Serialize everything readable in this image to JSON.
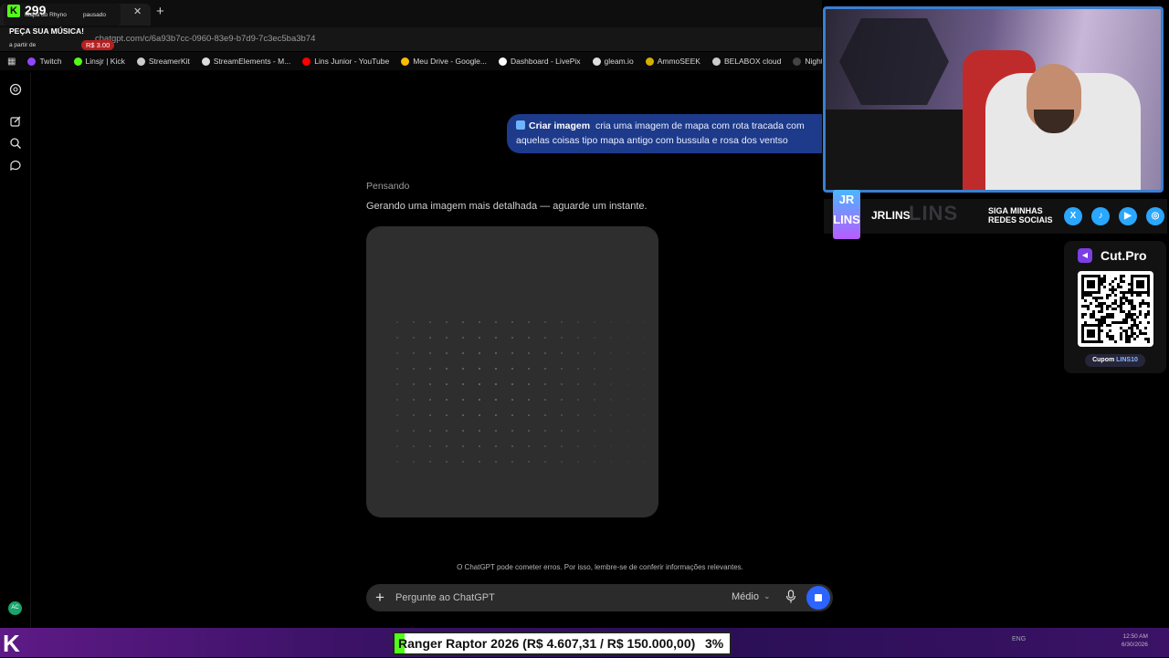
{
  "browser": {
    "tab_title": "Mapa do Rhyno",
    "url": "chatgpt.com/c/6a93b7cc-0960-83e9-b7d9-7c3ec5ba3b74",
    "bookmarks": [
      {
        "label": "Twitch",
        "color": "#9146ff"
      },
      {
        "label": "Linsjr | Kick",
        "color": "#53fc18"
      },
      {
        "label": "StreamerKit",
        "color": "#cccccc"
      },
      {
        "label": "StreamElements - M...",
        "color": "#dddddd"
      },
      {
        "label": "Lins Junior - YouTube",
        "color": "#ff0000"
      },
      {
        "label": "Meu Drive - Google...",
        "color": "#fbbc04"
      },
      {
        "label": "Dashboard - LivePix",
        "color": "#ffffff"
      },
      {
        "label": "gleam.io",
        "color": "#e0e0e0"
      },
      {
        "label": "AmmoSEEK",
        "color": "#d4b000"
      },
      {
        "label": "BELABOX cloud",
        "color": "#cccccc"
      },
      {
        "label": "Nightbot - Comm",
        "color": "#444444"
      }
    ]
  },
  "kick_overlay": {
    "count": "299",
    "song_label": "Mapa do Rhyno",
    "status": "pausado",
    "song_request": "PEÇA SUA MÚSICA!",
    "from_label": "a partir de",
    "price": "R$ 3.00"
  },
  "chat": {
    "user_tag": "Criar imagem",
    "user_message": "cria uma imagem de mapa com rota tracada com aquelas coisas tipo mapa antigo com bussula e rosa dos ventso",
    "thinking": "Pensando",
    "generating": "Gerando uma imagem mais detalhada — aguarde um instante.",
    "disclaimer": "O ChatGPT pode cometer erros. Por isso, lembre-se de conferir informações relevantes.",
    "composer_placeholder": "Pergunte ao ChatGPT",
    "model": "Médio",
    "avatar_initials": "AC"
  },
  "stream_overlay": {
    "social_name": "JRLINS",
    "social_ghost": "LINS",
    "social_cta": "SIGA MINHAS REDES SOCIAIS",
    "logo_text": "JR LINS",
    "cutpro_name": "Cut.Pro",
    "coupon_label": "Cupom",
    "coupon_code": "LINS10",
    "accent_color": "#53fc18",
    "brand_color": "#2b64ff"
  },
  "goal": {
    "text": "Ranger Raptor 2026 (R$ 4.607,31 / R$ 150.000,00)",
    "percent_label": "3%",
    "progress": 0.03
  },
  "system": {
    "lang": "ENG",
    "time": "12:50 AM",
    "date": "6/30/2026"
  }
}
